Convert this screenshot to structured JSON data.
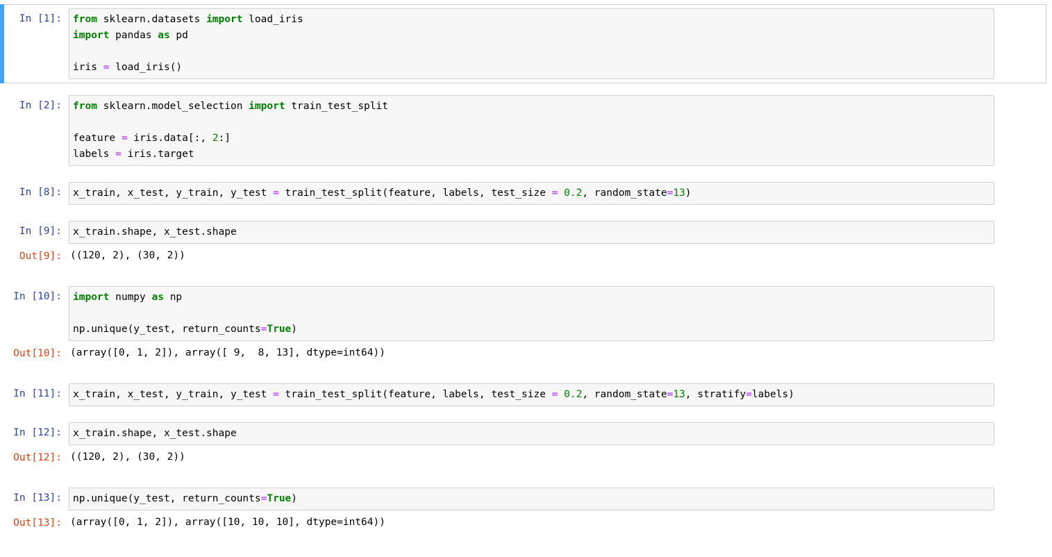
{
  "notebook": {
    "cells": [
      {
        "id": "cell-1",
        "selected": true,
        "prompt_in": "In [1]:",
        "code_lines": [
          [
            {
              "t": "from",
              "c": "k"
            },
            {
              "t": " sklearn.datasets ",
              "c": "p"
            },
            {
              "t": "import",
              "c": "k"
            },
            {
              "t": " load_iris",
              "c": "p"
            }
          ],
          [
            {
              "t": "import",
              "c": "k"
            },
            {
              "t": " pandas ",
              "c": "p"
            },
            {
              "t": "as",
              "c": "k"
            },
            {
              "t": " pd",
              "c": "p"
            }
          ],
          [
            {
              "t": "",
              "c": "p"
            }
          ],
          [
            {
              "t": "iris ",
              "c": "p"
            },
            {
              "t": "=",
              "c": "o"
            },
            {
              "t": " load_iris()",
              "c": "p"
            }
          ]
        ],
        "output": null
      },
      {
        "id": "cell-2",
        "selected": false,
        "prompt_in": "In [2]:",
        "code_lines": [
          [
            {
              "t": "from",
              "c": "k"
            },
            {
              "t": " sklearn.model_selection ",
              "c": "p"
            },
            {
              "t": "import",
              "c": "k"
            },
            {
              "t": " train_test_split",
              "c": "p"
            }
          ],
          [
            {
              "t": "",
              "c": "p"
            }
          ],
          [
            {
              "t": "feature ",
              "c": "p"
            },
            {
              "t": "=",
              "c": "o"
            },
            {
              "t": " iris.data[:, ",
              "c": "p"
            },
            {
              "t": "2",
              "c": "n"
            },
            {
              "t": ":]",
              "c": "p"
            }
          ],
          [
            {
              "t": "labels ",
              "c": "p"
            },
            {
              "t": "=",
              "c": "o"
            },
            {
              "t": " iris.target",
              "c": "p"
            }
          ]
        ],
        "output": null
      },
      {
        "id": "cell-3",
        "selected": false,
        "prompt_in": "In [8]:",
        "code_lines": [
          [
            {
              "t": "x_train, x_test, y_train, y_test ",
              "c": "p"
            },
            {
              "t": "=",
              "c": "o"
            },
            {
              "t": " train_test_split(feature, labels, test_size ",
              "c": "p"
            },
            {
              "t": "=",
              "c": "o"
            },
            {
              "t": " ",
              "c": "p"
            },
            {
              "t": "0.2",
              "c": "n"
            },
            {
              "t": ", random_state",
              "c": "p"
            },
            {
              "t": "=",
              "c": "o"
            },
            {
              "t": "13",
              "c": "n"
            },
            {
              "t": ")",
              "c": "p"
            }
          ]
        ],
        "output": null
      },
      {
        "id": "cell-4",
        "selected": false,
        "prompt_in": "In [9]:",
        "code_lines": [
          [
            {
              "t": "x_train.shape, x_test.shape",
              "c": "p"
            }
          ]
        ],
        "prompt_out": "Out[9]:",
        "output": "((120, 2), (30, 2))"
      },
      {
        "id": "cell-5",
        "selected": false,
        "prompt_in": "In [10]:",
        "code_lines": [
          [
            {
              "t": "import",
              "c": "k"
            },
            {
              "t": " numpy ",
              "c": "p"
            },
            {
              "t": "as",
              "c": "k"
            },
            {
              "t": " np",
              "c": "p"
            }
          ],
          [
            {
              "t": "",
              "c": "p"
            }
          ],
          [
            {
              "t": "np.unique(y_test, return_counts",
              "c": "p"
            },
            {
              "t": "=",
              "c": "o"
            },
            {
              "t": "True",
              "c": "kc"
            },
            {
              "t": ")",
              "c": "p"
            }
          ]
        ],
        "prompt_out": "Out[10]:",
        "output": "(array([0, 1, 2]), array([ 9,  8, 13], dtype=int64))"
      },
      {
        "id": "cell-6",
        "selected": false,
        "prompt_in": "In [11]:",
        "code_lines": [
          [
            {
              "t": "x_train, x_test, y_train, y_test ",
              "c": "p"
            },
            {
              "t": "=",
              "c": "o"
            },
            {
              "t": " train_test_split(feature, labels, test_size ",
              "c": "p"
            },
            {
              "t": "=",
              "c": "o"
            },
            {
              "t": " ",
              "c": "p"
            },
            {
              "t": "0.2",
              "c": "n"
            },
            {
              "t": ", random_state",
              "c": "p"
            },
            {
              "t": "=",
              "c": "o"
            },
            {
              "t": "13",
              "c": "n"
            },
            {
              "t": ", stratify",
              "c": "p"
            },
            {
              "t": "=",
              "c": "o"
            },
            {
              "t": "labels)",
              "c": "p"
            }
          ]
        ],
        "output": null
      },
      {
        "id": "cell-7",
        "selected": false,
        "prompt_in": "In [12]:",
        "code_lines": [
          [
            {
              "t": "x_train.shape, x_test.shape",
              "c": "p"
            }
          ]
        ],
        "prompt_out": "Out[12]:",
        "output": "((120, 2), (30, 2))"
      },
      {
        "id": "cell-8",
        "selected": false,
        "prompt_in": "In [13]:",
        "code_lines": [
          [
            {
              "t": "np.unique(y_test, return_counts",
              "c": "p"
            },
            {
              "t": "=",
              "c": "o"
            },
            {
              "t": "True",
              "c": "kc"
            },
            {
              "t": ")",
              "c": "p"
            }
          ]
        ],
        "prompt_out": "Out[13]:",
        "output": "(array([0, 1, 2]), array([10, 10, 10], dtype=int64))"
      }
    ],
    "colors": {
      "selected_bar": "#42a5f5",
      "prompt_in": "#303f9f",
      "prompt_out": "#d84315",
      "keyword": "#008000",
      "operator": "#aa22ff",
      "number": "#008000",
      "code_bg": "#f7f7f7",
      "code_border": "#cfcfcf"
    }
  }
}
